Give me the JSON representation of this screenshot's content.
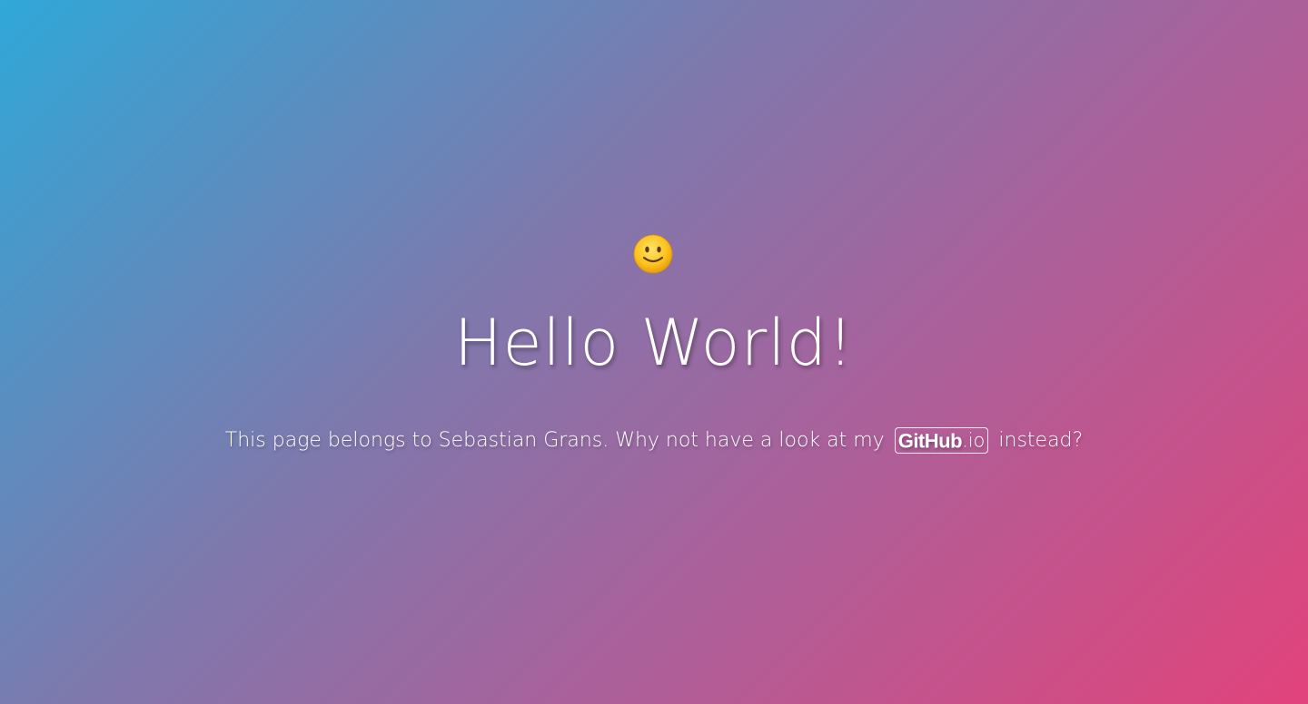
{
  "page": {
    "emoji_icon": "slightly-smiling-face-icon",
    "title": "Hello World!",
    "subtitle": {
      "text_before": "This page belongs to Sebastian Grans. Why not have a look at my",
      "link_bold": "GitHub",
      "link_suffix": ".io",
      "text_after": "instead?"
    }
  },
  "colors": {
    "gradient_start": "#2fa8d8",
    "gradient_mid": "#a8629c",
    "gradient_end": "#e2437b",
    "text": "#ffffff"
  }
}
